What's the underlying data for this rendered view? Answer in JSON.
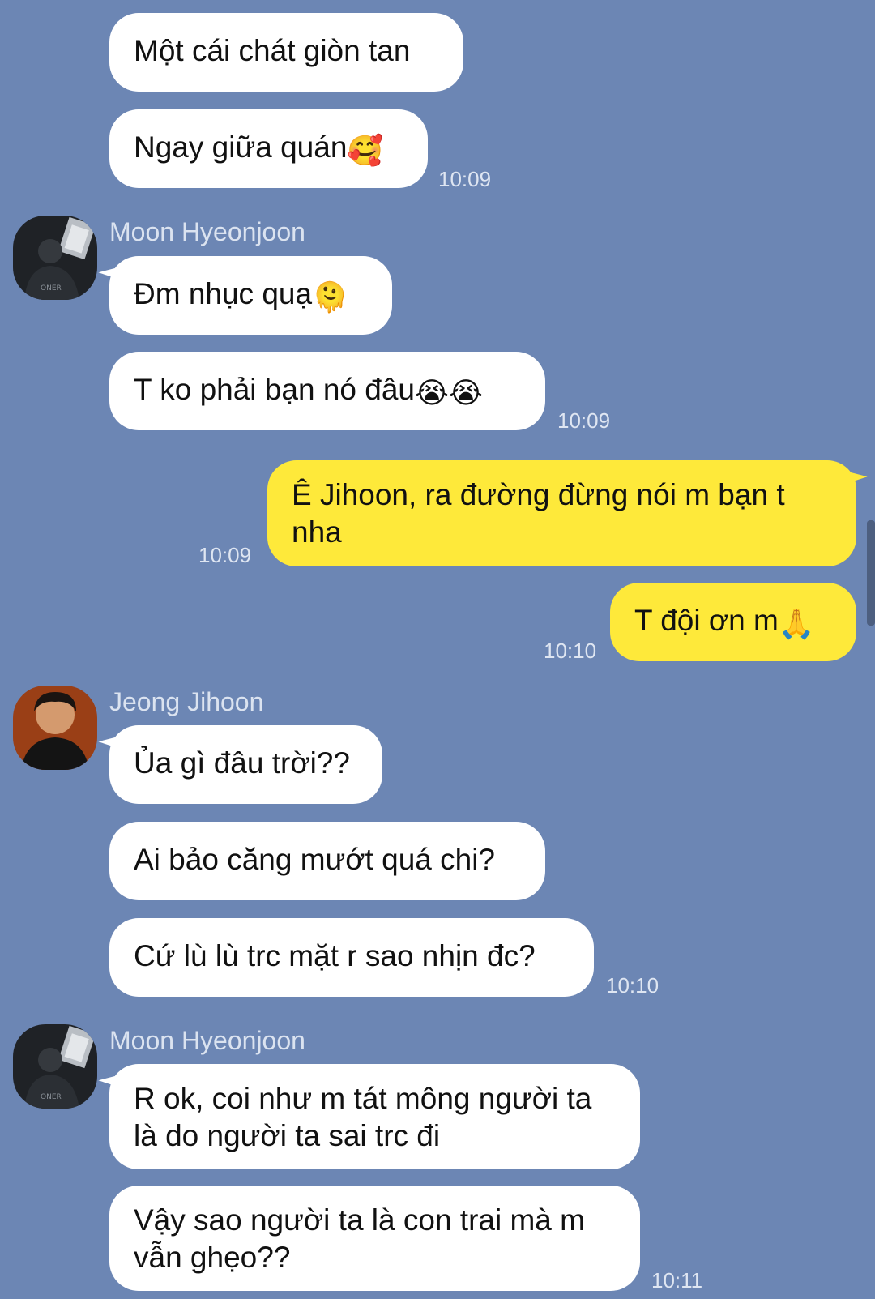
{
  "messages": [
    {
      "text": "Một cái chát giòn tan"
    },
    {
      "text": "Ngay giữa quán",
      "emoji": "🥰",
      "time": "10:09"
    },
    {
      "sender": "Moon Hyeonjoon"
    },
    {
      "text": "Đm nhục quạ",
      "emoji": "🫠"
    },
    {
      "text": "T ko phải bạn nó đâu",
      "emoji": "😭😭",
      "time": "10:09"
    },
    {
      "text": "Ê Jihoon, ra đường đừng nói m bạn t nha",
      "time": "10:09"
    },
    {
      "text": "T đội ơn m",
      "emoji": "🙏",
      "time": "10:10"
    },
    {
      "sender": "Jeong Jihoon"
    },
    {
      "text": "Ủa gì đâu trời??"
    },
    {
      "text": "Ai bảo căng mướt quá chi?"
    },
    {
      "text": "Cứ lù lù trc mặt r sao nhịn đc?",
      "time": "10:10"
    },
    {
      "sender": "Moon Hyeonjoon"
    },
    {
      "text": "R ok, coi như m tát mông người ta là do người ta sai trc đi"
    },
    {
      "text": "Vậy sao người ta là con trai mà m vẫn ghẹo??",
      "time": "10:11"
    }
  ],
  "colors": {
    "background": "#6c86b4",
    "incoming_bubble": "#ffffff",
    "outgoing_bubble": "#fee93a"
  },
  "icons": {
    "avatar_moon": "profile-photo-icon",
    "avatar_jeong": "profile-photo-icon"
  }
}
